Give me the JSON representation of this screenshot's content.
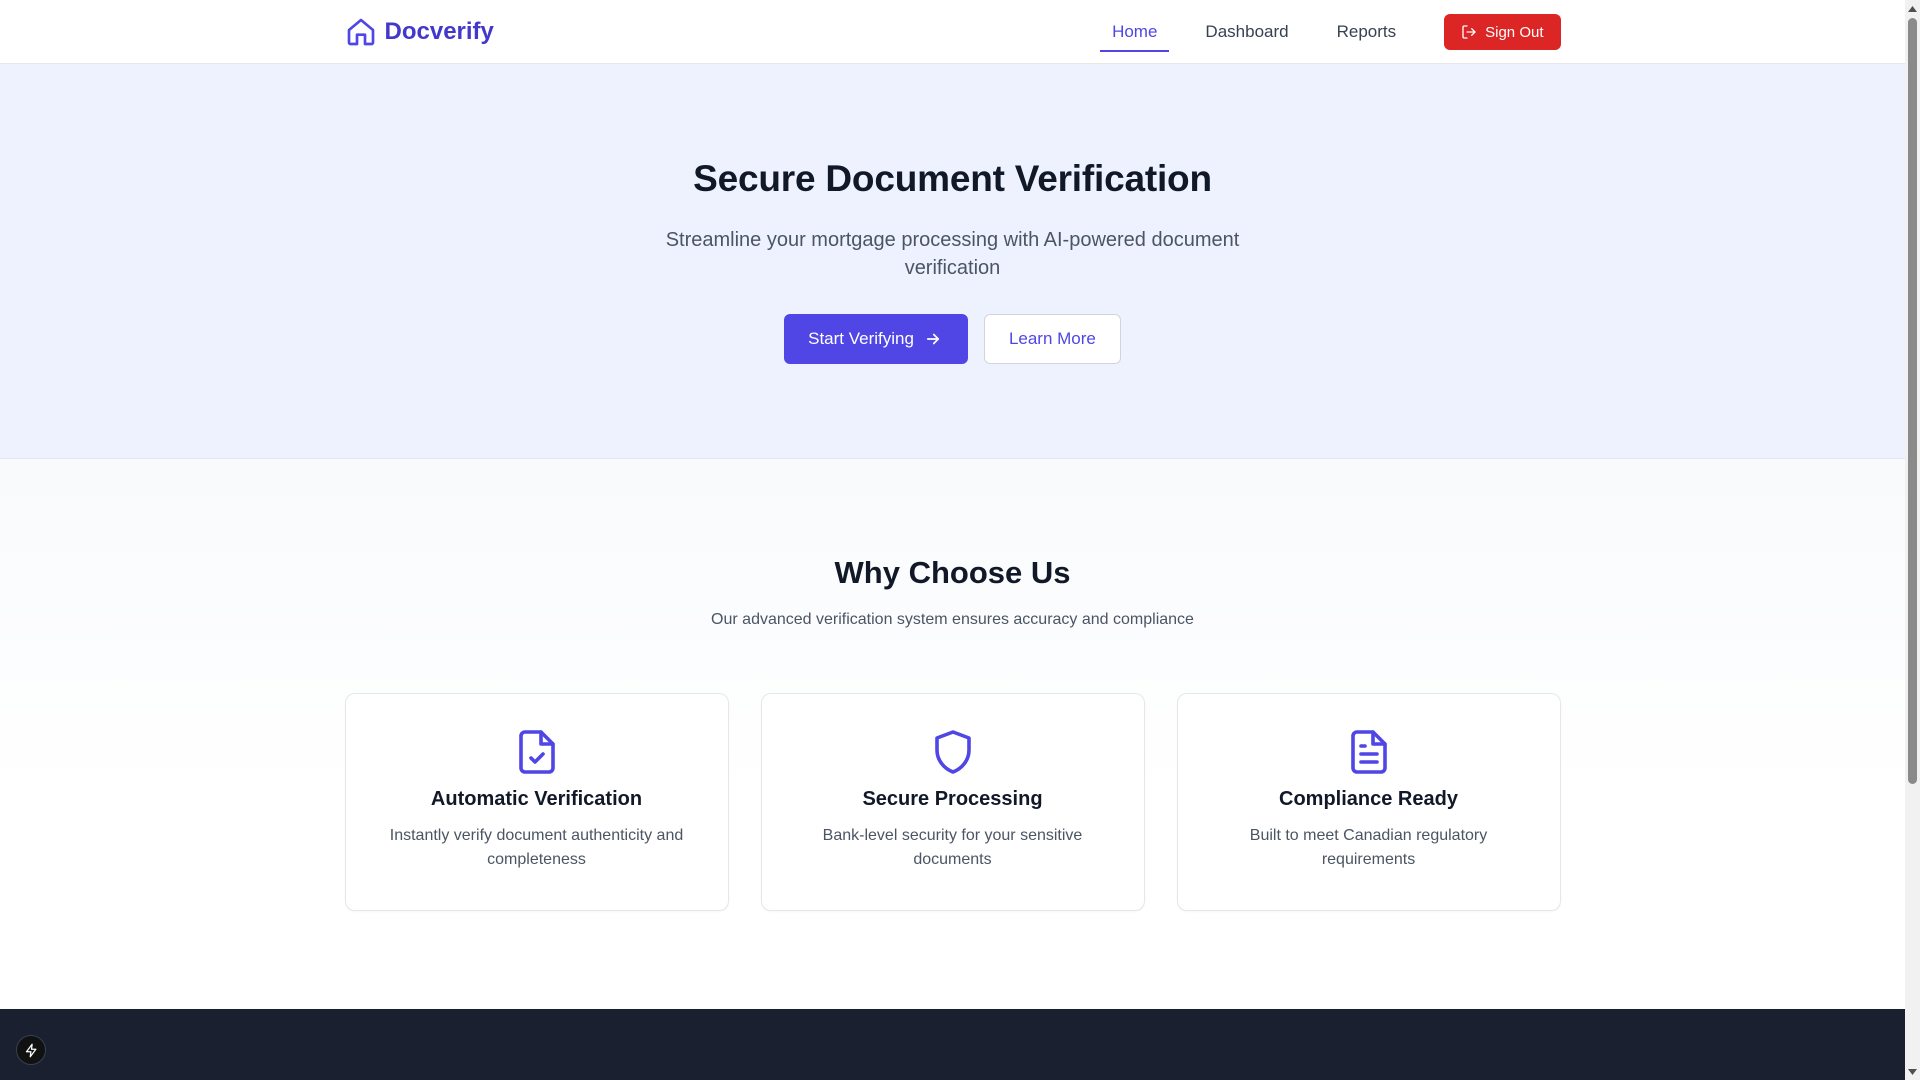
{
  "navbar": {
    "brand": {
      "name": "Docverify",
      "icon": "home-icon"
    },
    "links": [
      {
        "label": "Home",
        "active": true
      },
      {
        "label": "Dashboard",
        "active": false
      },
      {
        "label": "Reports",
        "active": false
      }
    ],
    "signout": {
      "label": "Sign Out",
      "icon": "logout-icon"
    }
  },
  "hero": {
    "title": "Secure Document Verification",
    "subtitle": "Streamline your mortgage processing with AI-powered document verification",
    "primary_button": {
      "label": "Start Verifying",
      "icon": "arrow-right-icon"
    },
    "secondary_button": {
      "label": "Learn More"
    }
  },
  "features": {
    "title": "Why Choose Us",
    "subtitle": "Our advanced verification system ensures accuracy and compliance",
    "cards": [
      {
        "title": "Automatic Verification",
        "description": "Instantly verify document authenticity and completeness",
        "icon": "file-check-icon"
      },
      {
        "title": "Secure Processing",
        "description": "Bank-level security for your sensitive documents",
        "icon": "shield-icon"
      },
      {
        "title": "Compliance Ready",
        "description": "Built to meet Canadian regulatory requirements",
        "icon": "file-text-icon"
      }
    ]
  },
  "colors": {
    "brand": "#4338ca",
    "accent": "#4f46e5",
    "danger": "#dc2626",
    "hero_bg": "#eef2ff",
    "footer_bg": "#1a2030"
  }
}
